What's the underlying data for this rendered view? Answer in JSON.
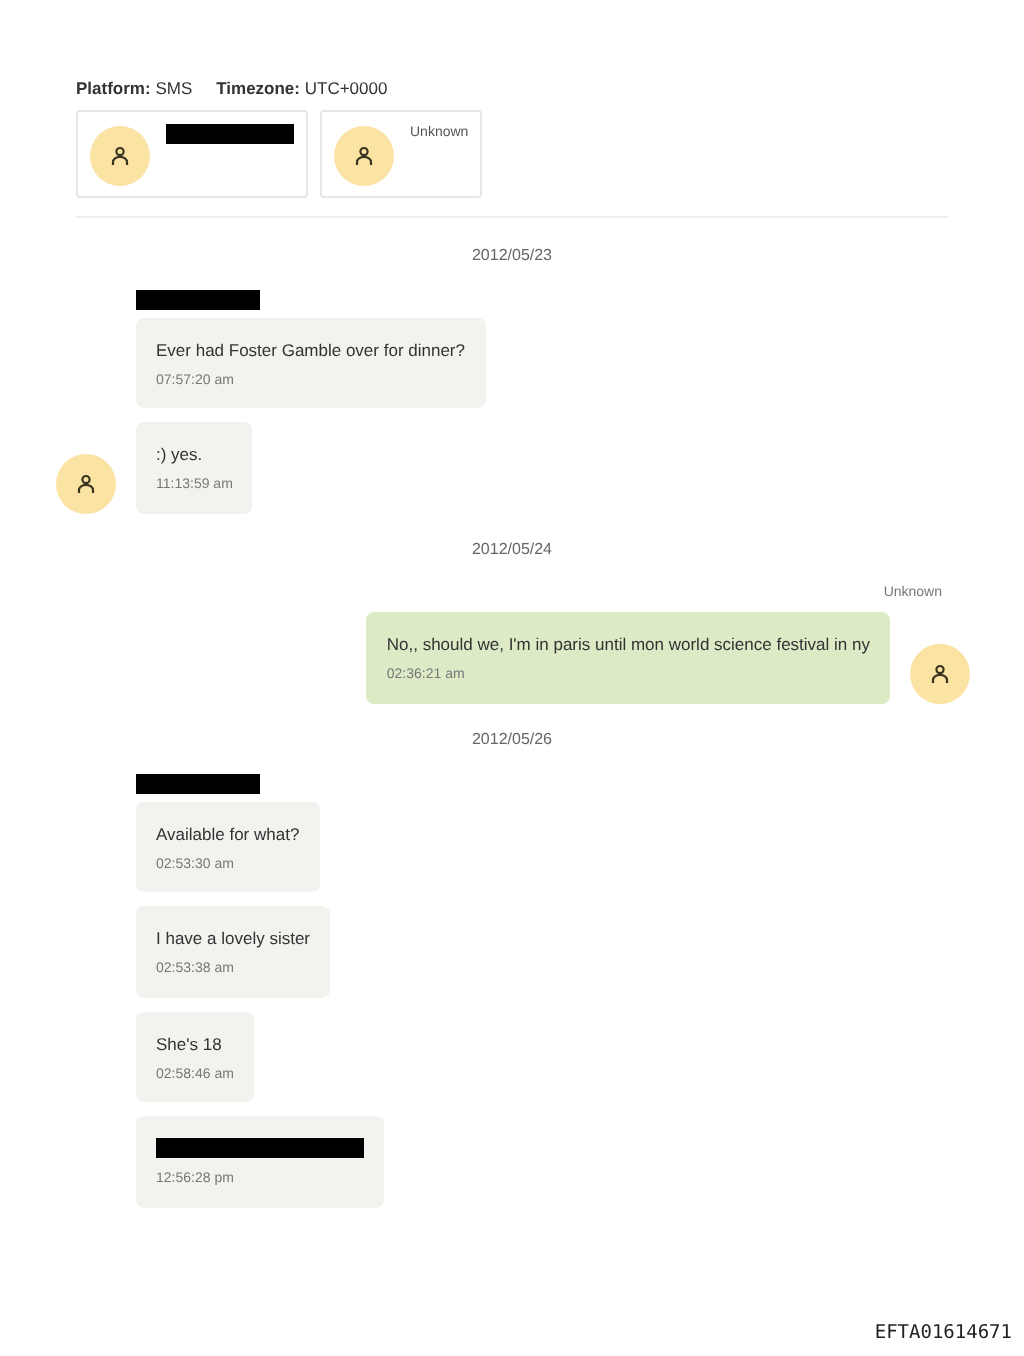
{
  "header": {
    "platform_label": "Platform:",
    "platform": "SMS",
    "timezone_label": "Timezone:",
    "timezone": "UTC+0000"
  },
  "participants": [
    {
      "redacted": true
    },
    {
      "redacted": false,
      "name": "Unknown"
    }
  ],
  "items": [
    {
      "kind": "date",
      "text": "2012/05/23"
    },
    {
      "kind": "sender",
      "outgoing": false,
      "redacted": true
    },
    {
      "kind": "message",
      "outgoing": false,
      "avatar": false,
      "redacted": false,
      "text": "Ever had Foster Gamble over for dinner?",
      "time": "07:57:20 am"
    },
    {
      "kind": "message",
      "outgoing": false,
      "avatar": true,
      "redacted": false,
      "text": ":) yes.",
      "time": "11:13:59 am"
    },
    {
      "kind": "date",
      "text": "2012/05/24"
    },
    {
      "kind": "sender",
      "outgoing": true,
      "redacted": false,
      "name": "Unknown"
    },
    {
      "kind": "message",
      "outgoing": true,
      "avatar": true,
      "redacted": false,
      "text": "No,, should we, I'm in paris until mon world science festival in ny",
      "time": "02:36:21 am"
    },
    {
      "kind": "date",
      "text": "2012/05/26"
    },
    {
      "kind": "sender",
      "outgoing": false,
      "redacted": true
    },
    {
      "kind": "message",
      "outgoing": false,
      "avatar": false,
      "redacted": false,
      "text": "Available for what?",
      "time": "02:53:30 am"
    },
    {
      "kind": "message",
      "outgoing": false,
      "avatar": false,
      "redacted": false,
      "text": "I have a lovely sister",
      "time": "02:53:38 am"
    },
    {
      "kind": "message",
      "outgoing": false,
      "avatar": false,
      "redacted": false,
      "text": "She's 18",
      "time": "02:58:46 am"
    },
    {
      "kind": "message",
      "outgoing": false,
      "avatar": false,
      "redacted": true,
      "time": "12:56:28 pm"
    }
  ],
  "footer": "EFTA01614671"
}
